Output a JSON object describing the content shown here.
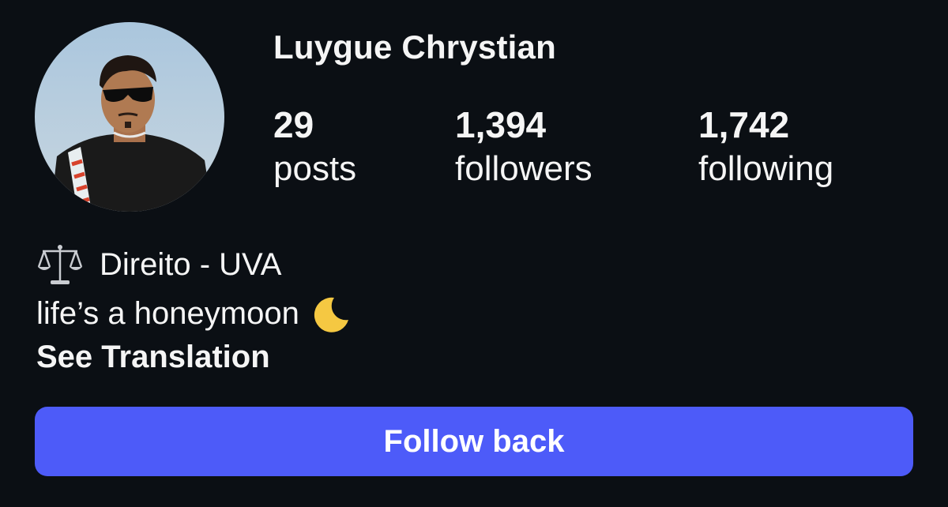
{
  "profile": {
    "username": "Luygue Chrystian",
    "avatar_icon": "profile-photo",
    "stats": {
      "posts": {
        "value": "29",
        "label": "posts"
      },
      "followers": {
        "value": "1,394",
        "label": "followers"
      },
      "following": {
        "value": "1,742",
        "label": "following"
      }
    },
    "bio": {
      "line1_icon": "balance-scale-icon",
      "line1_text": "Direito - UVA",
      "line2_text": "life’s a honeymoon",
      "line2_icon": "crescent-moon-icon"
    },
    "see_translation": "See Translation"
  },
  "actions": {
    "follow_back_label": "Follow back"
  },
  "colors": {
    "background": "#0b0f14",
    "text": "#f5f5f5",
    "button": "#4d5bf9",
    "moon": "#f5c842"
  }
}
